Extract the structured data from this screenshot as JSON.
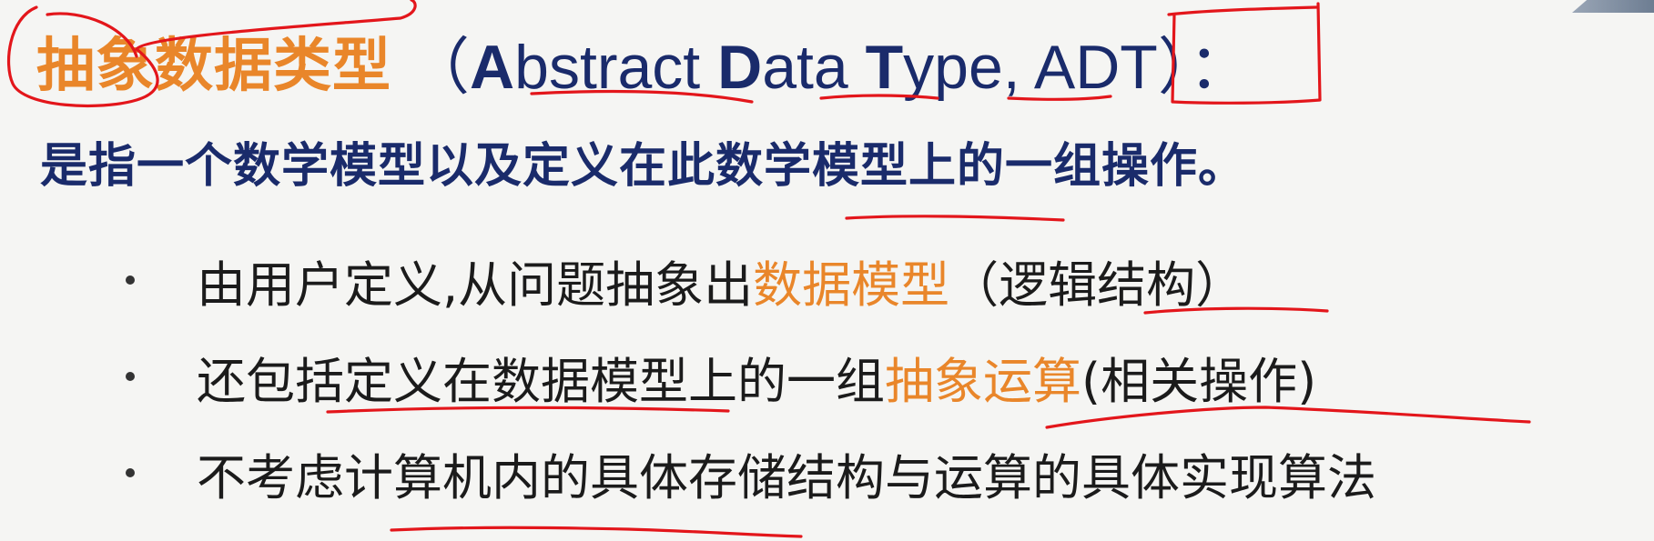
{
  "title": {
    "cn": "抽象数据类型",
    "en_open": "（",
    "en_a": "A",
    "en_bstract": "bstract ",
    "en_d": "D",
    "en_ata": "ata ",
    "en_t": "T",
    "en_ype": "ype, ",
    "en_adt": "ADT",
    "en_close": "）："
  },
  "definition": "是指一个数学模型以及定义在此数学模型上的一组操作。",
  "bullets": [
    {
      "before": "由用户定义,从问题抽象出",
      "highlight": "数据模型",
      "after": "（逻辑结构）"
    },
    {
      "before": "还包括定义在数据模型上的一组",
      "highlight": "抽象运算",
      "after": "(相关操作)"
    },
    {
      "before": "不考虑计算机内的具体存储结构与运算的具体实现算法",
      "highlight": "",
      "after": ""
    }
  ],
  "colors": {
    "accent": "#e9862a",
    "title_blue": "#1a2b6b",
    "annotation_red": "#e3161b",
    "background": "#f5f5f3"
  }
}
